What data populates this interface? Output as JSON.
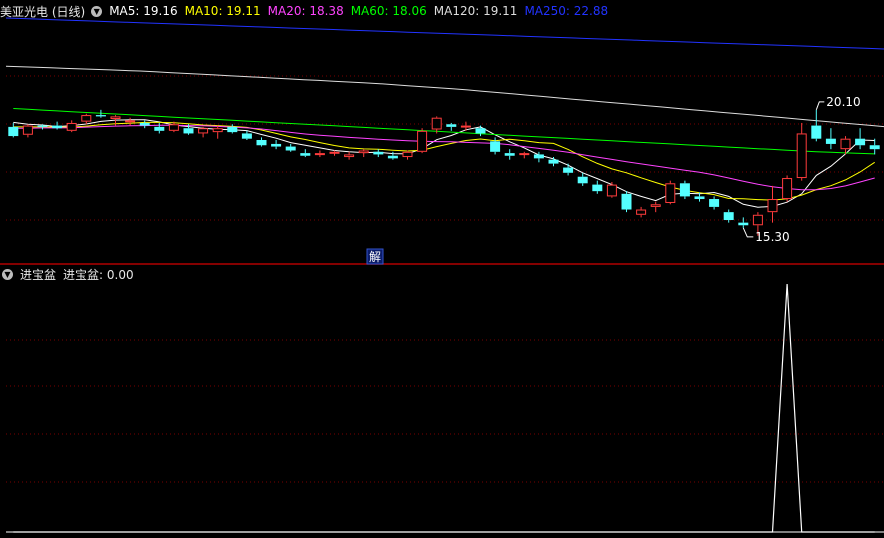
{
  "main_legend": {
    "title": "美亚光电 (日线)",
    "ma": [
      {
        "label": "MA5: 19.16",
        "color": "#ffffff"
      },
      {
        "label": "MA10: 19.11",
        "color": "#ffff00"
      },
      {
        "label": "MA20: 18.38",
        "color": "#ff44ff"
      },
      {
        "label": "MA60: 18.06",
        "color": "#00ff00"
      },
      {
        "label": "MA120: 19.11",
        "color": "#dddddd"
      },
      {
        "label": "MA250: 22.88",
        "color": "#2233ff"
      }
    ]
  },
  "sub_legend": {
    "name": "进宝盆",
    "value": "进宝盆: 0.00"
  },
  "badge": "解",
  "colors": {
    "up": "#ff3c3c",
    "down": "#54ffff",
    "grid": "#7a0000",
    "separator": "#b00000"
  },
  "chart_data": [
    {
      "type": "candlestick",
      "title": "美亚光电 (日线)",
      "y_range": [
        14.3,
        23.6
      ],
      "annotations": [
        {
          "text": "20.10",
          "kind": "high",
          "index": 55
        },
        {
          "text": "15.30",
          "kind": "low",
          "index": 50
        }
      ],
      "candles": [
        [
          19.45,
          19.6,
          19.05,
          19.1
        ],
        [
          19.15,
          19.55,
          19.05,
          19.5
        ],
        [
          19.5,
          19.55,
          19.35,
          19.45
        ],
        [
          19.5,
          19.65,
          19.35,
          19.4
        ],
        [
          19.3,
          19.7,
          19.25,
          19.6
        ],
        [
          19.65,
          19.95,
          19.55,
          19.9
        ],
        [
          19.9,
          20.1,
          19.8,
          19.85
        ],
        [
          19.75,
          19.9,
          19.5,
          19.85
        ],
        [
          19.7,
          19.8,
          19.5,
          19.7
        ],
        [
          19.6,
          19.7,
          19.4,
          19.5
        ],
        [
          19.45,
          19.6,
          19.2,
          19.3
        ],
        [
          19.3,
          19.65,
          19.25,
          19.55
        ],
        [
          19.4,
          19.55,
          19.15,
          19.2
        ],
        [
          19.2,
          19.45,
          19.05,
          19.4
        ],
        [
          19.25,
          19.5,
          19.0,
          19.4
        ],
        [
          19.45,
          19.55,
          19.2,
          19.25
        ],
        [
          19.2,
          19.3,
          18.95,
          19.0
        ],
        [
          18.95,
          19.05,
          18.7,
          18.75
        ],
        [
          18.8,
          18.95,
          18.6,
          18.7
        ],
        [
          18.7,
          18.8,
          18.5,
          18.55
        ],
        [
          18.45,
          18.6,
          18.3,
          18.35
        ],
        [
          18.4,
          18.55,
          18.3,
          18.45
        ],
        [
          18.45,
          18.55,
          18.35,
          18.5
        ],
        [
          18.3,
          18.5,
          18.2,
          18.4
        ],
        [
          18.45,
          18.6,
          18.3,
          18.55
        ],
        [
          18.5,
          18.6,
          18.3,
          18.4
        ],
        [
          18.35,
          18.5,
          18.2,
          18.25
        ],
        [
          18.3,
          18.55,
          18.2,
          18.5
        ],
        [
          18.5,
          19.4,
          18.45,
          19.3
        ],
        [
          19.35,
          19.85,
          19.2,
          19.8
        ],
        [
          19.55,
          19.6,
          19.3,
          19.45
        ],
        [
          19.45,
          19.65,
          19.3,
          19.5
        ],
        [
          19.4,
          19.5,
          19.1,
          19.2
        ],
        [
          18.9,
          19.05,
          18.4,
          18.5
        ],
        [
          18.45,
          18.6,
          18.2,
          18.35
        ],
        [
          18.4,
          18.5,
          18.25,
          18.45
        ],
        [
          18.4,
          18.5,
          18.1,
          18.25
        ],
        [
          18.2,
          18.3,
          17.95,
          18.05
        ],
        [
          17.9,
          18.05,
          17.6,
          17.7
        ],
        [
          17.55,
          17.7,
          17.2,
          17.3
        ],
        [
          17.25,
          17.4,
          16.9,
          17.0
        ],
        [
          16.8,
          17.35,
          16.75,
          17.25
        ],
        [
          16.9,
          17.0,
          16.2,
          16.3
        ],
        [
          16.1,
          16.4,
          16.0,
          16.3
        ],
        [
          16.4,
          16.6,
          16.2,
          16.5
        ],
        [
          16.55,
          17.4,
          16.5,
          17.3
        ],
        [
          17.3,
          17.4,
          16.7,
          16.8
        ],
        [
          16.8,
          16.95,
          16.6,
          16.7
        ],
        [
          16.7,
          16.8,
          16.3,
          16.4
        ],
        [
          16.2,
          16.3,
          15.8,
          15.9
        ],
        [
          15.8,
          16.0,
          15.6,
          15.7
        ],
        [
          15.7,
          16.2,
          15.3,
          16.1
        ],
        [
          16.2,
          17.2,
          15.8,
          16.7
        ],
        [
          16.7,
          17.6,
          16.6,
          17.5
        ],
        [
          17.5,
          19.6,
          17.4,
          19.2
        ],
        [
          19.5,
          20.1,
          18.9,
          19.0
        ],
        [
          19.0,
          19.4,
          18.6,
          18.8
        ],
        [
          18.6,
          19.1,
          18.4,
          19.0
        ],
        [
          19.0,
          19.4,
          18.6,
          18.75
        ],
        [
          18.75,
          19.0,
          18.4,
          18.6
        ]
      ],
      "moving_averages": [
        {
          "name": "MA5",
          "color": "#ffffff",
          "values": [
            19.62,
            19.55,
            19.52,
            19.46,
            19.5,
            19.56,
            19.66,
            19.71,
            19.72,
            19.72,
            19.64,
            19.52,
            19.46,
            19.4,
            19.36,
            19.34,
            19.31,
            19.16,
            19.02,
            18.85,
            18.75,
            18.65,
            18.55,
            18.5,
            18.47,
            18.48,
            18.43,
            18.42,
            18.62,
            18.96,
            19.12,
            19.34,
            19.45,
            19.15,
            18.88,
            18.65,
            18.38,
            18.23,
            17.99,
            17.7,
            17.48,
            17.25,
            16.98,
            16.8,
            16.64,
            16.88,
            16.92,
            16.9,
            16.95,
            16.8,
            16.5,
            16.39,
            16.42,
            16.58,
            16.9,
            17.6,
            17.95,
            18.42,
            18.95,
            18.93
          ]
        },
        {
          "name": "MA10",
          "color": "#ffff00",
          "values": [
            19.45,
            19.45,
            19.45,
            19.44,
            19.44,
            19.48,
            19.53,
            19.57,
            19.59,
            19.62,
            19.62,
            19.61,
            19.57,
            19.52,
            19.5,
            19.47,
            19.43,
            19.33,
            19.2,
            19.07,
            18.97,
            18.85,
            18.74,
            18.65,
            18.61,
            18.6,
            18.56,
            18.53,
            18.56,
            18.7,
            18.82,
            18.93,
            18.99,
            18.92,
            18.98,
            18.92,
            18.85,
            18.82,
            18.59,
            18.31,
            18.06,
            17.85,
            17.7,
            17.51,
            17.33,
            17.16,
            17.03,
            16.94,
            16.87,
            16.72,
            16.71,
            16.68,
            16.66,
            16.71,
            16.85,
            17.06,
            17.21,
            17.43,
            17.73,
            18.1
          ]
        },
        {
          "name": "MA20",
          "color": "#ff44ff",
          "values": [
            19.4,
            19.4,
            19.41,
            19.41,
            19.42,
            19.44,
            19.46,
            19.48,
            19.49,
            19.5,
            19.51,
            19.51,
            19.5,
            19.49,
            19.47,
            19.44,
            19.41,
            19.37,
            19.31,
            19.24,
            19.18,
            19.13,
            19.09,
            19.05,
            19.02,
            18.98,
            18.95,
            18.92,
            18.9,
            18.89,
            18.88,
            18.86,
            18.84,
            18.82,
            18.77,
            18.7,
            18.63,
            18.56,
            18.48,
            18.39,
            18.3,
            18.21,
            18.12,
            18.04,
            17.96,
            17.88,
            17.8,
            17.72,
            17.62,
            17.5,
            17.38,
            17.26,
            17.17,
            17.1,
            17.05,
            17.05,
            17.1,
            17.2,
            17.35,
            17.5
          ]
        },
        {
          "name": "MA60",
          "color": "#00ff00",
          "values": [
            20.15,
            20.12,
            20.09,
            20.06,
            20.03,
            20.0,
            19.97,
            19.94,
            19.91,
            19.88,
            19.85,
            19.82,
            19.79,
            19.76,
            19.73,
            19.7,
            19.67,
            19.64,
            19.61,
            19.58,
            19.55,
            19.52,
            19.49,
            19.46,
            19.43,
            19.4,
            19.37,
            19.34,
            19.31,
            19.28,
            19.25,
            19.22,
            19.19,
            19.16,
            19.13,
            19.1,
            19.07,
            19.04,
            19.01,
            18.98,
            18.95,
            18.92,
            18.89,
            18.86,
            18.83,
            18.8,
            18.77,
            18.74,
            18.71,
            18.68,
            18.65,
            18.62,
            18.59,
            18.56,
            18.53,
            18.5,
            18.48,
            18.46,
            18.44,
            18.42
          ]
        },
        {
          "name": "MA120",
          "color": "#dddddd",
          "values": [
            21.76,
            21.74,
            21.72,
            21.7,
            21.68,
            21.66,
            21.64,
            21.62,
            21.6,
            21.58,
            21.55,
            21.52,
            21.49,
            21.46,
            21.43,
            21.4,
            21.37,
            21.34,
            21.31,
            21.28,
            21.25,
            21.22,
            21.19,
            21.16,
            21.13,
            21.1,
            21.06,
            21.02,
            20.98,
            20.94,
            20.9,
            20.86,
            20.81,
            20.76,
            20.71,
            20.66,
            20.61,
            20.56,
            20.51,
            20.46,
            20.41,
            20.36,
            20.31,
            20.26,
            20.21,
            20.16,
            20.11,
            20.06,
            20.01,
            19.96,
            19.91,
            19.86,
            19.81,
            19.76,
            19.71,
            19.66,
            19.61,
            19.56,
            19.51,
            19.46
          ]
        },
        {
          "name": "MA250",
          "color": "#2233ff",
          "values": [
            23.6,
            23.58,
            23.56,
            23.54,
            23.52,
            23.5,
            23.48,
            23.46,
            23.44,
            23.42,
            23.4,
            23.38,
            23.36,
            23.34,
            23.32,
            23.3,
            23.28,
            23.26,
            23.24,
            23.22,
            23.2,
            23.18,
            23.16,
            23.14,
            23.12,
            23.1,
            23.08,
            23.06,
            23.04,
            23.02,
            23.0,
            22.98,
            22.96,
            22.94,
            22.92,
            22.9,
            22.88,
            22.86,
            22.84,
            22.82,
            22.8,
            22.78,
            22.76,
            22.74,
            22.72,
            22.7,
            22.68,
            22.66,
            22.64,
            22.62,
            22.6,
            22.58,
            22.56,
            22.54,
            22.52,
            22.5,
            22.48,
            22.46,
            22.44,
            22.42
          ]
        }
      ]
    },
    {
      "type": "line",
      "title": "进宝盆",
      "y_range": [
        0,
        1
      ],
      "series": [
        {
          "name": "进宝盆",
          "color": "#ffffff",
          "values": [
            0,
            0,
            0,
            0,
            0,
            0,
            0,
            0,
            0,
            0,
            0,
            0,
            0,
            0,
            0,
            0,
            0,
            0,
            0,
            0,
            0,
            0,
            0,
            0,
            0,
            0,
            0,
            0,
            0,
            0,
            0,
            0,
            0,
            0,
            0,
            0,
            0,
            0,
            0,
            0,
            0,
            0,
            0,
            0,
            0,
            0,
            0,
            0,
            0,
            0,
            0,
            0,
            0,
            1,
            0,
            0,
            0,
            0,
            0,
            0
          ]
        }
      ]
    }
  ]
}
